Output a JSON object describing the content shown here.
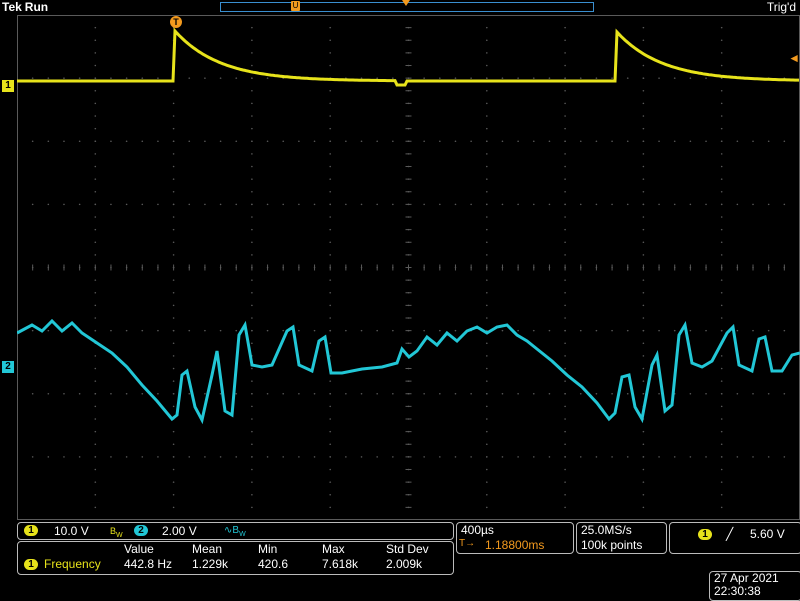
{
  "header": {
    "brand": "Tek",
    "status": "Run",
    "trig_state": "Trig'd",
    "record_marker": "U",
    "trigger_marker": "T"
  },
  "channels": [
    {
      "id": "1",
      "color": "#e7e31b",
      "scale": "10.0 V",
      "coupling_icon": "bandwidth-icon"
    },
    {
      "id": "2",
      "color": "#22c7d6",
      "scale": "2.00 V",
      "coupling_icon": "invert-icon"
    }
  ],
  "channel_markers": {
    "ch1": "1",
    "ch2": "2"
  },
  "measurement": {
    "headers": [
      "Value",
      "Mean",
      "Min",
      "Max",
      "Std Dev"
    ],
    "channel": "1",
    "name": "Frequency",
    "values": [
      "442.8 Hz",
      "1.229k",
      "420.6",
      "7.618k",
      "2.009k"
    ]
  },
  "timebase": {
    "scale": "400µs",
    "trigger_delay_icon": "T→",
    "position": "1.18800ms"
  },
  "acquisition": {
    "sample_rate": "25.0MS/s",
    "record_length": "100k points"
  },
  "trigger": {
    "source": "1",
    "slope_icon": "rising-edge-icon",
    "slope_glyph": "╱",
    "level": "5.60 V"
  },
  "datetime": {
    "date": "27 Apr  2021",
    "time": "22:30:38"
  },
  "colors": {
    "ch1": "#e7e31b",
    "ch2": "#22c7d6",
    "trigger": "#f39a1e",
    "record_bar": "#3a8fd0",
    "grid": "#5a5a5a"
  }
}
